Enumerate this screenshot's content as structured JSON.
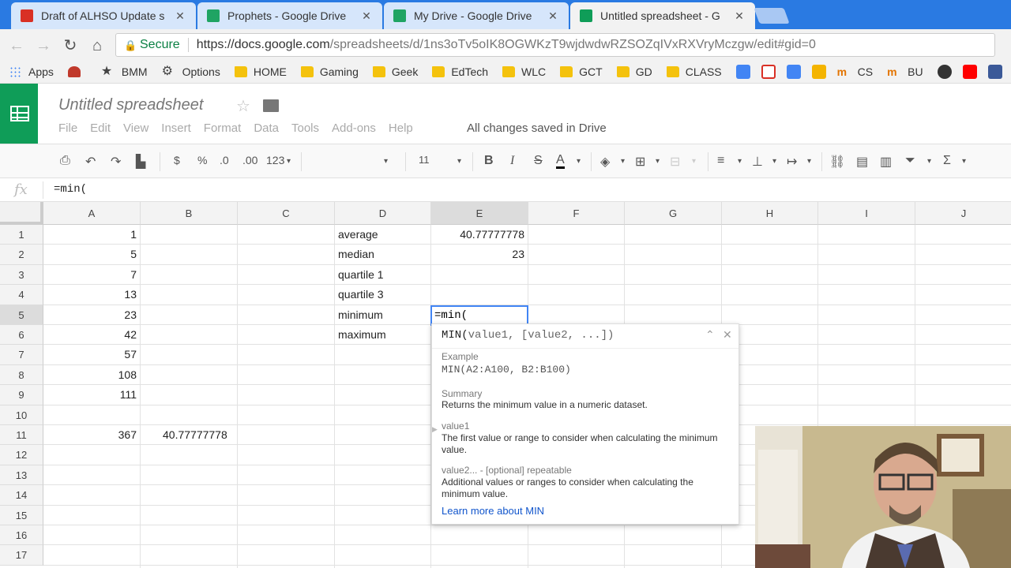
{
  "tabs": [
    {
      "title": "Draft of ALHSO Update s",
      "favicon": "gmail-icon",
      "color": "#d93025"
    },
    {
      "title": "Prophets - Google Drive",
      "favicon": "drive-icon",
      "color": "#1fa463"
    },
    {
      "title": "My Drive - Google Drive",
      "favicon": "drive-icon",
      "color": "#1fa463"
    },
    {
      "title": "Untitled spreadsheet - G",
      "favicon": "sheets-icon",
      "color": "#0f9d58"
    }
  ],
  "address": {
    "secure_label": "Secure",
    "host": "https://docs.google.com",
    "path": "/spreadsheets/d/1ns3oTv5oIK8OGWKzT9wjdwdwRZSOZqIVxRXVryMczgw/edit#gid=0"
  },
  "bookmarks": [
    {
      "label": "Apps",
      "icon": "apps-icon"
    },
    {
      "label": "",
      "icon": "a-icon"
    },
    {
      "label": "BMM",
      "icon": "star-icon"
    },
    {
      "label": "Options",
      "icon": "gear-icon"
    },
    {
      "label": "HOME",
      "icon": "folder-icon"
    },
    {
      "label": "Gaming",
      "icon": "folder-icon"
    },
    {
      "label": "Geek",
      "icon": "folder-icon"
    },
    {
      "label": "EdTech",
      "icon": "folder-icon"
    },
    {
      "label": "WLC",
      "icon": "folder-icon"
    },
    {
      "label": "GCT",
      "icon": "folder-icon"
    },
    {
      "label": "GD",
      "icon": "folder-icon"
    },
    {
      "label": "CLASS",
      "icon": "folder-icon"
    }
  ],
  "bookmarks_right": [
    {
      "label": "",
      "icon": "keep-icon",
      "color": "#4285f4"
    },
    {
      "label": "",
      "icon": "gmail-icon",
      "color": "#d93025"
    },
    {
      "label": "",
      "icon": "calendar-icon",
      "color": "#4285f4"
    },
    {
      "label": "",
      "icon": "bulb-icon",
      "color": "#f4b400"
    },
    {
      "label": "CS",
      "icon": "m-icon",
      "color": "#e37400"
    },
    {
      "label": "BU",
      "icon": "m-icon",
      "color": "#e37400"
    },
    {
      "label": "",
      "icon": "nhl-icon",
      "color": "#333333"
    },
    {
      "label": "",
      "icon": "youtube-icon",
      "color": "#ff0000"
    },
    {
      "label": "",
      "icon": "facebook-icon",
      "color": "#3b5998"
    },
    {
      "label": "",
      "icon": "telegram-icon",
      "color": "#2ca5e0"
    }
  ],
  "doc": {
    "title": "Untitled spreadsheet",
    "saved": "All changes saved in Drive"
  },
  "menu": [
    "File",
    "Edit",
    "View",
    "Insert",
    "Format",
    "Data",
    "Tools",
    "Add-ons",
    "Help"
  ],
  "toolbar": {
    "currency": "$",
    "percent": "%",
    "dec_less": ".0",
    "dec_more": ".00",
    "more_formats": "123",
    "font_size": "11",
    "bold": "B",
    "italic": "I",
    "strike": "S",
    "text_color": "A",
    "sum": "Σ"
  },
  "formula_bar": {
    "fx": "fx",
    "value": "=min("
  },
  "columns": [
    "A",
    "B",
    "C",
    "D",
    "E",
    "F",
    "G",
    "H",
    "I",
    "J"
  ],
  "rows": [
    "1",
    "2",
    "3",
    "4",
    "5",
    "6",
    "7",
    "8",
    "9",
    "10",
    "11",
    "12",
    "13",
    "14",
    "15",
    "16",
    "17"
  ],
  "cells": {
    "A1": "1",
    "A2": "5",
    "A3": "7",
    "A4": "13",
    "A5": "23",
    "A6": "42",
    "A7": "57",
    "A8": "108",
    "A9": "111",
    "A11": "367",
    "B11": "40.77777778",
    "D1": "average",
    "D2": "median",
    "D3": "quartile 1",
    "D4": "quartile 3",
    "D5": "minimum",
    "D6": "maximum",
    "E1": "40.77777778",
    "E2": "23",
    "E5": "=min( "
  },
  "help": {
    "signature_fn": "MIN(",
    "signature_args": "value1, [value2, ...])",
    "example_label": "Example",
    "example": "MIN(A2:A100, B2:B100)",
    "summary_label": "Summary",
    "summary": "Returns the minimum value in a numeric dataset.",
    "arg1_label": "value1",
    "arg1_desc": "The first value or range to consider when calculating the minimum value.",
    "arg2_label": "value2... - [optional] repeatable",
    "arg2_desc": "Additional values or ranges to consider when calculating the minimum value.",
    "link": "Learn more about MIN"
  }
}
